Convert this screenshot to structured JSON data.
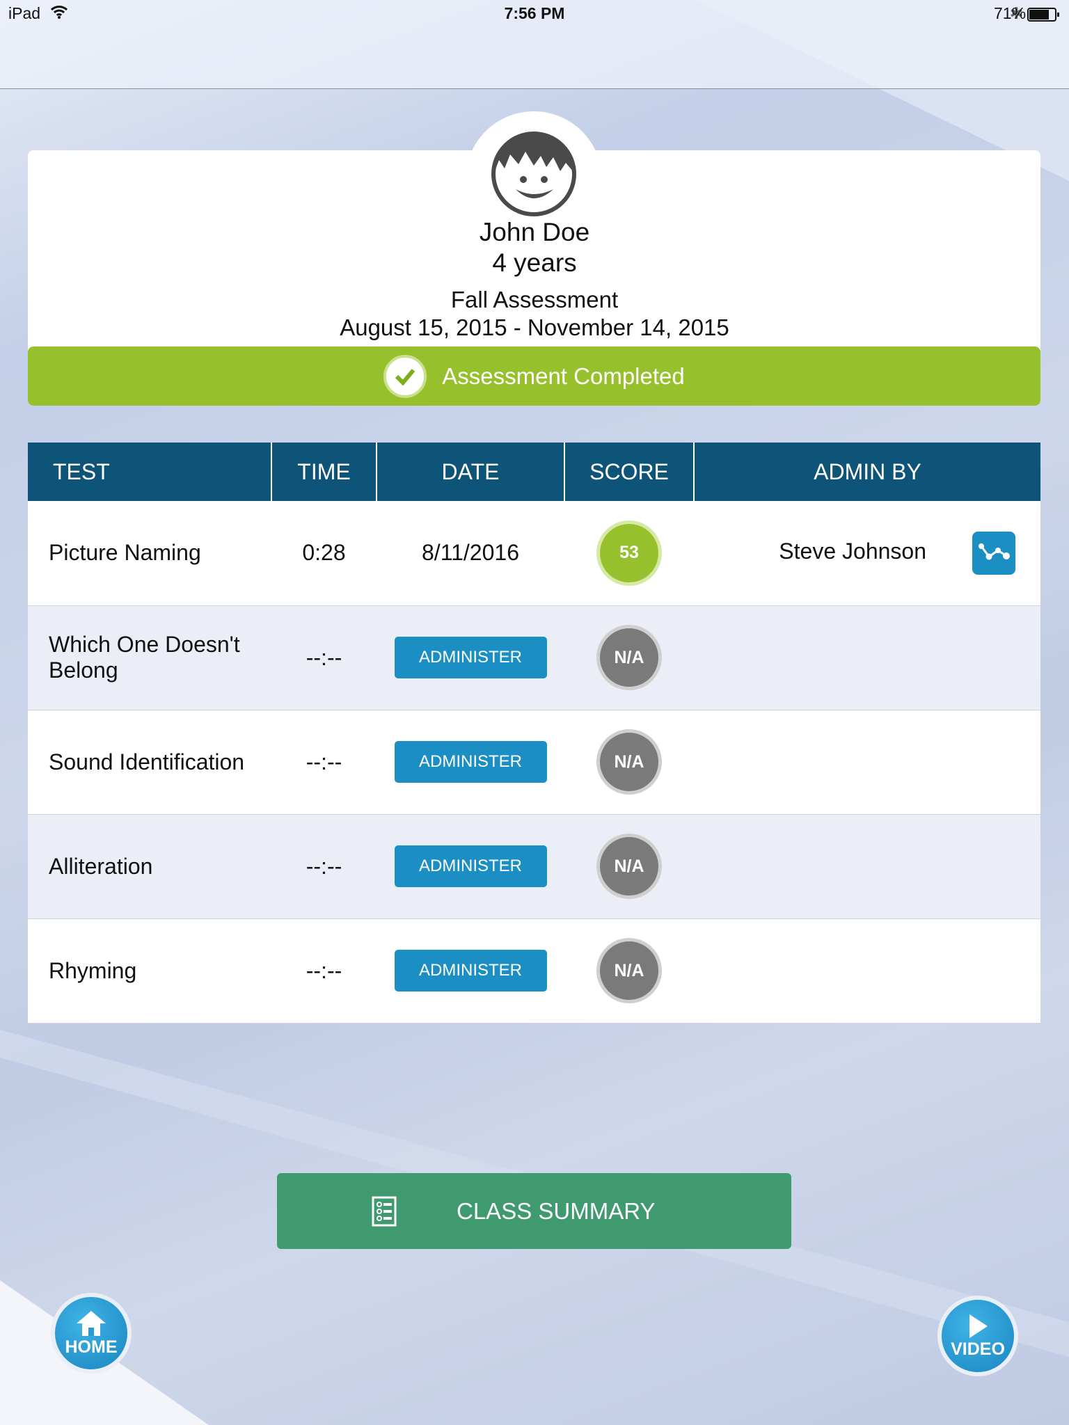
{
  "status_bar": {
    "device": "iPad",
    "time": "7:56 PM",
    "battery": "71%"
  },
  "student": {
    "name": "John Doe",
    "age": "4 years",
    "assessment": "Fall Assessment",
    "period": "August 15, 2015 - November 14, 2015",
    "status": "Assessment Completed"
  },
  "table": {
    "headers": [
      "TEST",
      "TIME",
      "DATE",
      "SCORE",
      "ADMIN BY"
    ],
    "rows": [
      {
        "test": "Picture Naming",
        "time": "0:28",
        "date": "8/11/2016",
        "score": "53",
        "admin_by": "Steve Johnson"
      },
      {
        "test": "Which One Doesn't Belong",
        "time": "--:--",
        "action": "ADMINISTER",
        "score": "N/A"
      },
      {
        "test": "Sound Identification",
        "time": "--:--",
        "action": "ADMINISTER",
        "score": "N/A"
      },
      {
        "test": "Alliteration",
        "time": "--:--",
        "action": "ADMINISTER",
        "score": "N/A"
      },
      {
        "test": "Rhyming",
        "time": "--:--",
        "action": "ADMINISTER",
        "score": "N/A"
      }
    ]
  },
  "buttons": {
    "class_summary": "CLASS SUMMARY",
    "home": "HOME",
    "video": "VIDEO"
  },
  "colors": {
    "header": "#0e5478",
    "completed": "#96c12c",
    "administer": "#1b8fc4",
    "summary": "#3f9a70"
  }
}
